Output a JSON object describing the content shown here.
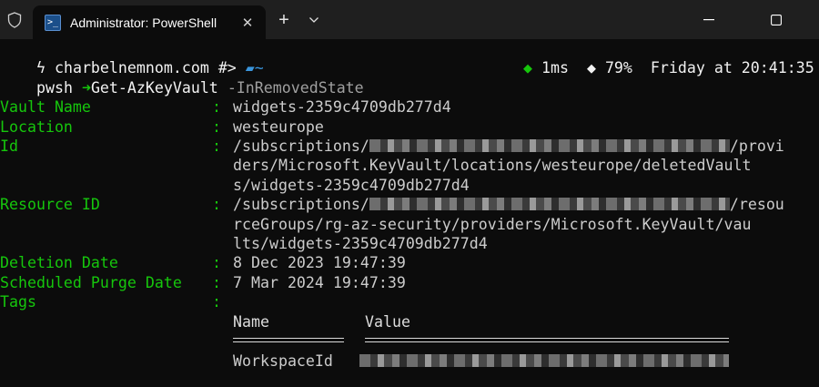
{
  "window": {
    "tab_title": "Administrator: PowerShell",
    "tab_icon": "powershell-icon",
    "new_tab_label": "+",
    "close_tab_label": "✕"
  },
  "prompt": {
    "bolt": "ϟ",
    "host": "charbelnemnom.com",
    "path_sep": "#>",
    "dir": "~",
    "timing": "1ms",
    "battery": "79%",
    "clock": "Friday at 20:41:35",
    "shell": "pwsh",
    "arrow": "➜",
    "command": "Get-AzKeyVault",
    "param": "-InRemovedState"
  },
  "output": {
    "vault_name_label": "Vault Name",
    "vault_name": "widgets-2359c4709db277d4",
    "location_label": "Location",
    "location": "westeurope",
    "id_label": "Id",
    "id_line1_prefix": "/subscriptions/",
    "id_line1_suffix": "/provi",
    "id_line2": "ders/Microsoft.KeyVault/locations/westeurope/deletedVault",
    "id_line3": "s/widgets-2359c4709db277d4",
    "resource_id_label": "Resource ID",
    "rid_line1_prefix": "/subscriptions/",
    "rid_line1_suffix": "/resou",
    "rid_line2": "rceGroups/rg-az-security/providers/Microsoft.KeyVault/vau",
    "rid_line3": "lts/widgets-2359c4709db277d4",
    "deletion_date_label": "Deletion Date",
    "deletion_date": "8 Dec 2023 19:47:39",
    "purge_date_label": "Scheduled Purge Date",
    "purge_date": "7 Mar 2024 19:47:39",
    "tags_label": "Tags",
    "colon": ":",
    "tags_header_name": "Name",
    "tags_header_value": "Value",
    "tag_name": "WorkspaceId"
  }
}
